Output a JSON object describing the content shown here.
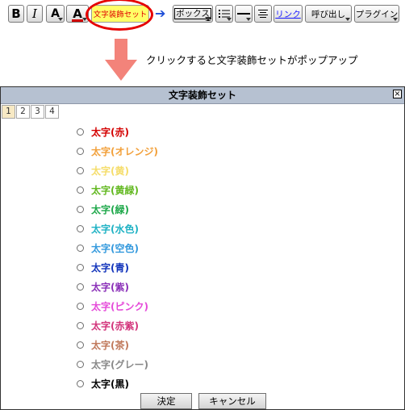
{
  "toolbar": {
    "bold": "B",
    "italic": "I",
    "size": "A",
    "color": "A",
    "deco_set": "文字装飾セット",
    "box": "ボックス",
    "link": "リンク",
    "call": "呼び出し",
    "plugin": "プラグイン"
  },
  "caption": "クリックすると文字装飾セットがポップアップ",
  "dialog": {
    "title": "文字装飾セット",
    "close": "×",
    "tabs": [
      "1",
      "2",
      "3",
      "4"
    ],
    "options": [
      {
        "label": "太字(赤)",
        "color": "#d40000"
      },
      {
        "label": "太字(オレンジ)",
        "color": "#f2a03a"
      },
      {
        "label": "太字(黄)",
        "color": "#f5dd6a"
      },
      {
        "label": "太字(黄緑)",
        "color": "#62b820"
      },
      {
        "label": "太字(緑)",
        "color": "#1ea84a"
      },
      {
        "label": "太字(水色)",
        "color": "#1fb2c4"
      },
      {
        "label": "太字(空色)",
        "color": "#3399dd"
      },
      {
        "label": "太字(青)",
        "color": "#1133bb"
      },
      {
        "label": "太字(紫)",
        "color": "#8a2fb8"
      },
      {
        "label": "太字(ピンク)",
        "color": "#e54ad9"
      },
      {
        "label": "太字(赤紫)",
        "color": "#d2337a"
      },
      {
        "label": "太字(茶)",
        "color": "#c0785a"
      },
      {
        "label": "太字(グレー)",
        "color": "#888888"
      },
      {
        "label": "太字(黒)",
        "color": "#000000"
      }
    ],
    "ok": "決定",
    "cancel": "キャンセル"
  },
  "colors": {
    "highlight": "#e60000",
    "arrow": "#f3837a",
    "titlebar": "#b6c1d1"
  }
}
